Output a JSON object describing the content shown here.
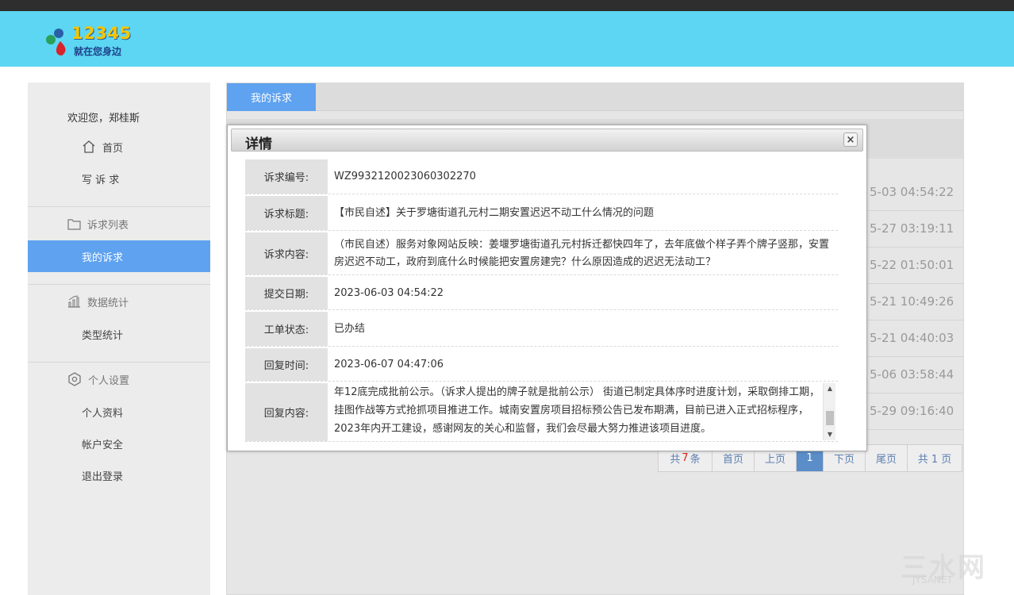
{
  "header": {
    "logo_number": "12345",
    "logo_slogan": "就在您身边",
    "colors": {
      "header_bg": "#5cd6f2",
      "accent": "#5fa2f0"
    }
  },
  "sidebar": {
    "welcome": "欢迎您，郑桂斯",
    "home": "首页",
    "write": "写 诉 求",
    "group_list": "诉求列表",
    "my_appeals": "我的诉求",
    "group_stats": "数据统计",
    "type_stats": "类型统计",
    "group_settings": "个人设置",
    "profile": "个人资料",
    "account_security": "帐户安全",
    "logout": "退出登录"
  },
  "main": {
    "tab": "我的诉求",
    "row_dates": [
      "5-03 04:54:22",
      "5-27 03:19:11",
      "5-22 01:50:01",
      "5-21 10:49:26",
      "5-21 04:40:03",
      "5-06 03:58:44",
      "5-29 09:16:40"
    ],
    "pager": {
      "total_prefix": "共",
      "total_count": "7",
      "total_suffix": "条",
      "first": "首页",
      "prev": "上页",
      "current": "1",
      "next": "下页",
      "last": "尾页",
      "pages": "共 1 页"
    }
  },
  "modal": {
    "title": "详情",
    "close": "×",
    "fields": {
      "id_label": "诉求编号:",
      "id_value": "WZ9932120023060302270",
      "title_label": "诉求标题:",
      "title_value": "【市民自述】关于罗塘街道孔元村二期安置迟迟不动工什么情况的问题",
      "content_label": "诉求内容:",
      "content_value": "（市民自述）服务对象网站反映：姜堰罗塘街道孔元村拆迁都快四年了，去年底做个样子弄个牌子竖那，安置房迟迟不动工，政府到底什么时候能把安置房建完？什么原因造成的迟迟无法动工？",
      "date_label": "提交日期:",
      "date_value": "2023-06-03 04:54:22",
      "status_label": "工单状态:",
      "status_value": "已办结",
      "reply_time_label": "回复时间:",
      "reply_time_value": "2023-06-07 04:47:06",
      "reply_label": "回复内容:",
      "reply_value": "年12底完成批前公示。（诉求人提出的牌子就是批前公示） 街道已制定具体序时进度计划，采取倒排工期，挂图作战等方式抢抓项目推进工作。城南安置房项目招标预公告已发布期满，目前已进入正式招标程序，2023年内开工建设，感谢网友的关心和监督，我们会尽最大努力推进该项目进度。"
    }
  },
  "watermark": {
    "main": "三水网",
    "sub": "JYSANET"
  }
}
